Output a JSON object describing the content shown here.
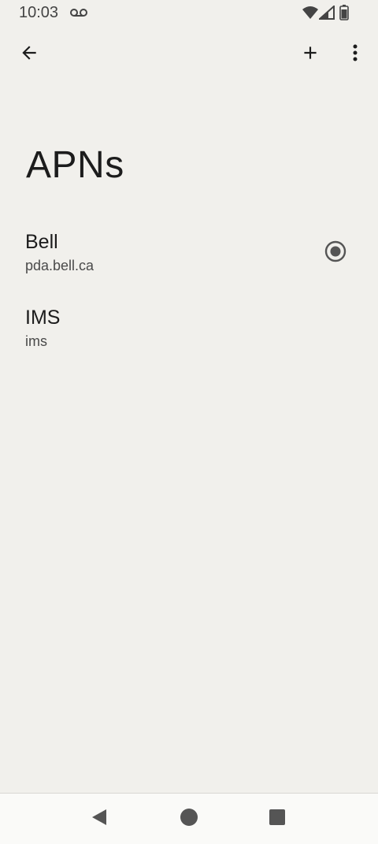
{
  "status_bar": {
    "time": "10:03",
    "icons": [
      "voicemail-icon",
      "wifi-icon",
      "signal-icon",
      "battery-icon"
    ]
  },
  "toolbar": {
    "back_icon": "arrow-back-icon",
    "add_icon": "add-icon",
    "more_icon": "more-vert-icon"
  },
  "page": {
    "title": "APNs"
  },
  "apns": [
    {
      "name": "Bell",
      "apn": "pda.bell.ca",
      "selected": true
    },
    {
      "name": "IMS",
      "apn": "ims",
      "selected": false
    }
  ],
  "nav_bar": {
    "icons": [
      "nav-back-icon",
      "nav-home-icon",
      "nav-recents-icon"
    ]
  },
  "colors": {
    "background": "#f1f0ec",
    "text": "#1c1c1c",
    "radio": "#555555"
  }
}
